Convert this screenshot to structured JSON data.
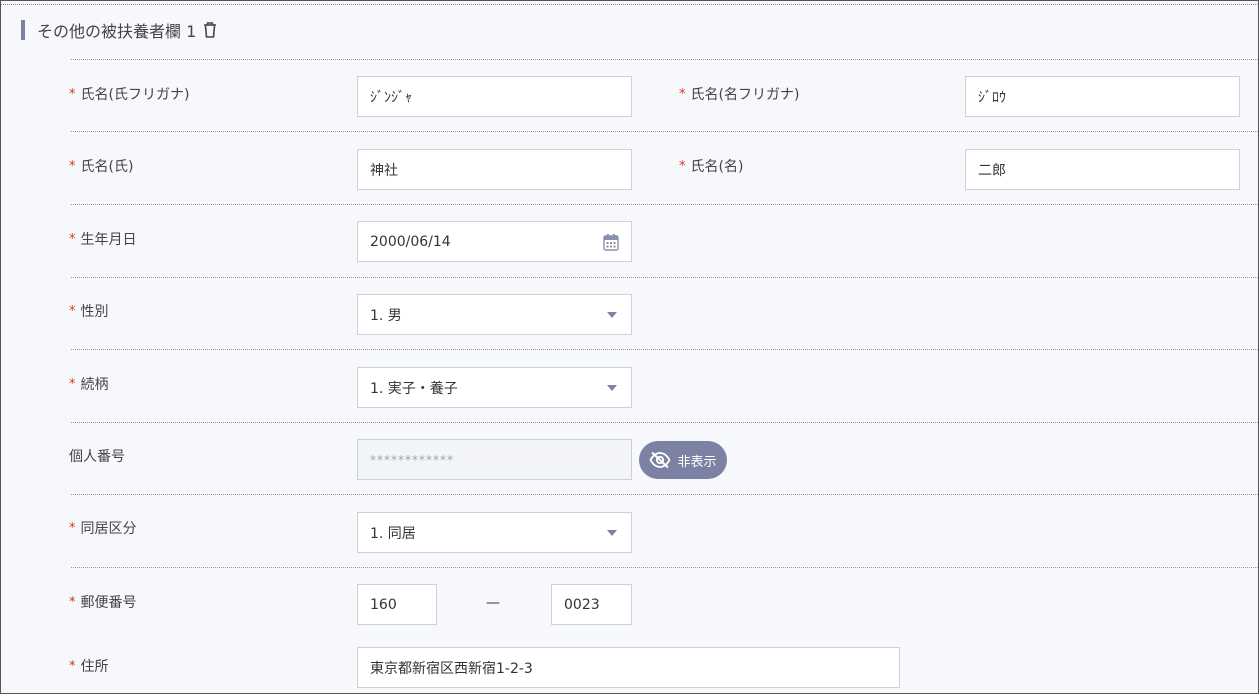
{
  "section": {
    "title": "その他の被扶養者欄 1"
  },
  "fields": {
    "kana_last": {
      "label": "氏名(氏フリガナ)",
      "value": "ｼﾞﾝｼﾞｬ",
      "required": "*"
    },
    "kana_first": {
      "label": "氏名(名フリガナ)",
      "value": "ｼﾞﾛｳ",
      "required": "*"
    },
    "name_last": {
      "label": "氏名(氏)",
      "value": "神社",
      "required": "*"
    },
    "name_first": {
      "label": "氏名(名)",
      "value": "二郎",
      "required": "*"
    },
    "birthdate": {
      "label": "生年月日",
      "value": "2000/06/14",
      "required": "*"
    },
    "gender": {
      "label": "性別",
      "value": "1. 男",
      "required": "*"
    },
    "relationship": {
      "label": "続柄",
      "value": "1. 実子・養子",
      "required": "*"
    },
    "my_number": {
      "label": "個人番号",
      "value": "************",
      "button": "非表示"
    },
    "cohabitation": {
      "label": "同居区分",
      "value": "1. 同居",
      "required": "*"
    },
    "postal": {
      "label": "郵便番号",
      "value1": "160",
      "separator": "—",
      "value2": "0023",
      "required": "*"
    },
    "address": {
      "label": "住所",
      "value": "東京都新宿区西新宿1-2-3",
      "required": "*"
    }
  },
  "colors": {
    "accent": "#7c82a3",
    "required": "#d9342b"
  },
  "icons": {
    "delete": "trash-icon",
    "calendar": "calendar-icon",
    "hide": "eye-off-icon",
    "dropdown": "chevron-down-icon"
  }
}
